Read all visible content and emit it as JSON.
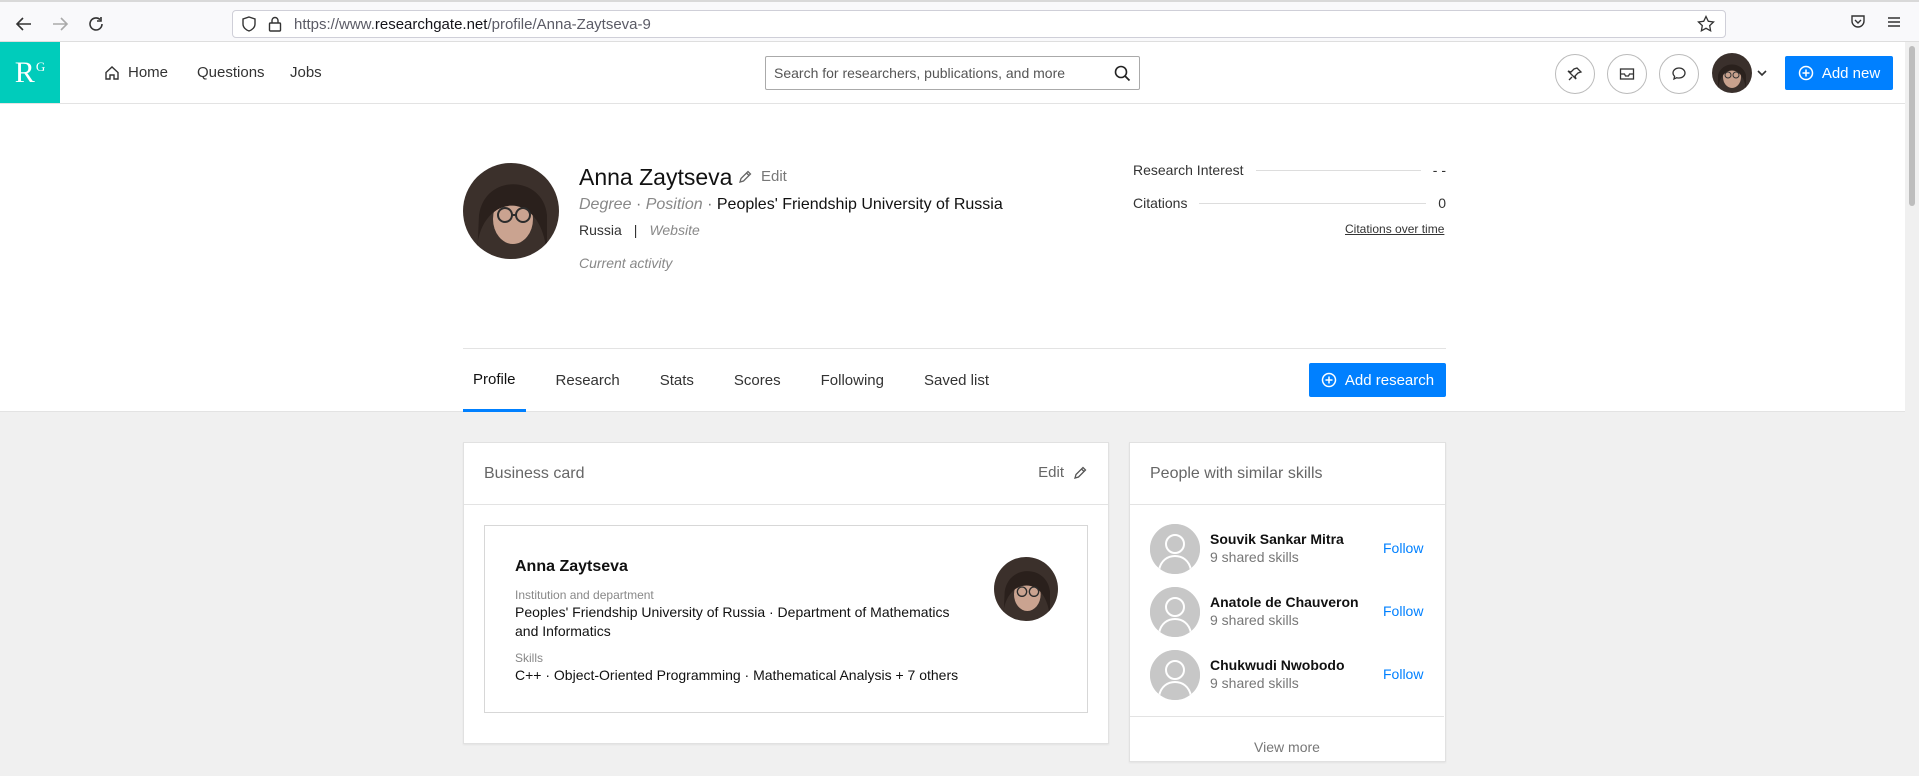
{
  "browser": {
    "url_prefix": "https://www.",
    "url_domain": "researchgate.net",
    "url_path": "/profile/Anna-Zaytseva-9"
  },
  "header": {
    "logo_main": "R",
    "logo_sup": "G",
    "nav": [
      "Home",
      "Questions",
      "Jobs"
    ],
    "search_placeholder": "Search for researchers, publications, and more",
    "add_new": "Add new"
  },
  "profile": {
    "name": "Anna Zaytseva",
    "edit": "Edit",
    "degree": "Degree",
    "position": "Position",
    "dot": "·",
    "institution": "Peoples' Friendship University of Russia",
    "country": "Russia",
    "separator": "|",
    "website": "Website",
    "activity": "Current activity",
    "research_interest_label": "Research Interest",
    "research_interest_value": "- -",
    "citations_label": "Citations",
    "citations_value": "0",
    "citations_link": "Citations over time"
  },
  "tabs": [
    "Profile",
    "Research",
    "Stats",
    "Scores",
    "Following",
    "Saved list"
  ],
  "add_research": "Add research",
  "business_card": {
    "title": "Business card",
    "edit": "Edit",
    "name": "Anna Zaytseva",
    "inst_label": "Institution and department",
    "inst_value": "Peoples' Friendship University of Russia · Department of Mathematics and Informatics",
    "skills_label": "Skills",
    "skills_value": "C++ · Object-Oriented Programming · Mathematical Analysis + 7 others"
  },
  "similar": {
    "title": "People with similar skills",
    "people": [
      {
        "name": "Souvik Sankar Mitra",
        "skills": "9 shared skills",
        "action": "Follow"
      },
      {
        "name": "Anatole de Chauveron",
        "skills": "9 shared skills",
        "action": "Follow"
      },
      {
        "name": "Chukwudi Nwobodo",
        "skills": "9 shared skills",
        "action": "Follow"
      }
    ],
    "view_more": "View more"
  },
  "colors": {
    "brand": "#00ccbb",
    "accent": "#0080ff"
  }
}
